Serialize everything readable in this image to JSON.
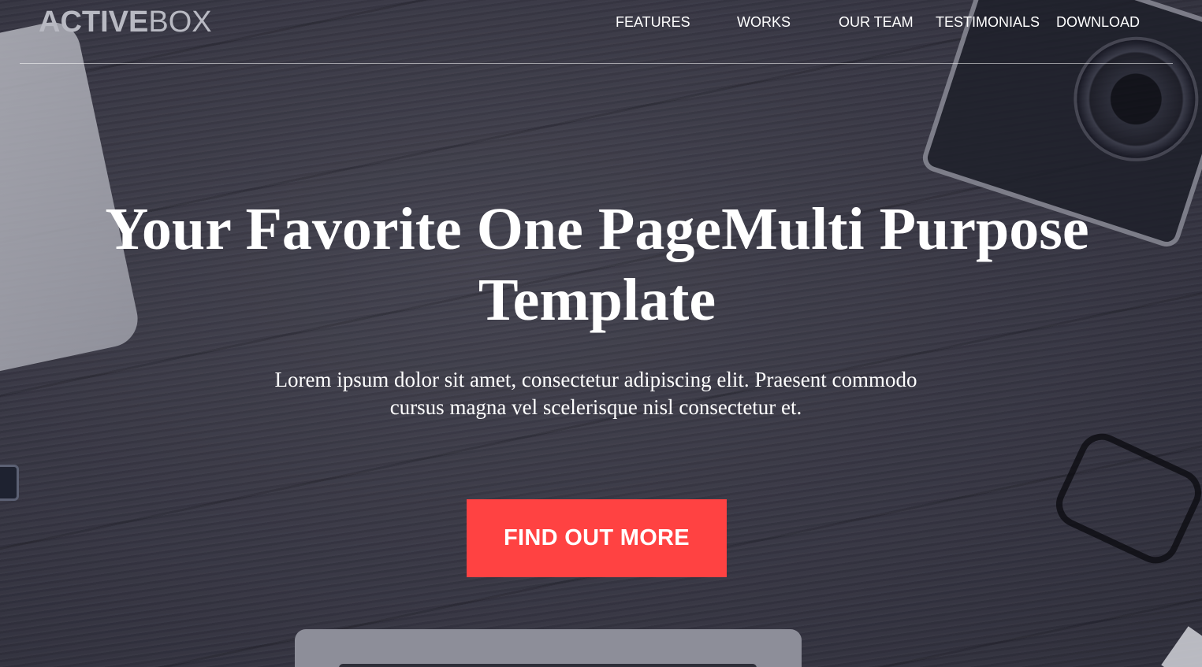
{
  "navbar": {
    "logo_bold": "ACTIVE",
    "logo_light": "BOX",
    "links": [
      {
        "label": "FEATURES"
      },
      {
        "label": "WORKS"
      },
      {
        "label": "OUR TEAM"
      },
      {
        "label": "TESTIMONIALS"
      },
      {
        "label": "DOWNLOAD"
      }
    ]
  },
  "hero": {
    "title": "Your Favorite One PageMulti Purpose Template",
    "subtitle": "Lorem ipsum dolor sit amet, consectetur adipiscing elit. Praesent commodo cursus magna vel scelerisque nisl consectetur et.",
    "cta_label": "FIND OUT MORE"
  },
  "colors": {
    "accent": "#ff4242",
    "text": "#ffffff",
    "logo": "#b8b9c2"
  }
}
